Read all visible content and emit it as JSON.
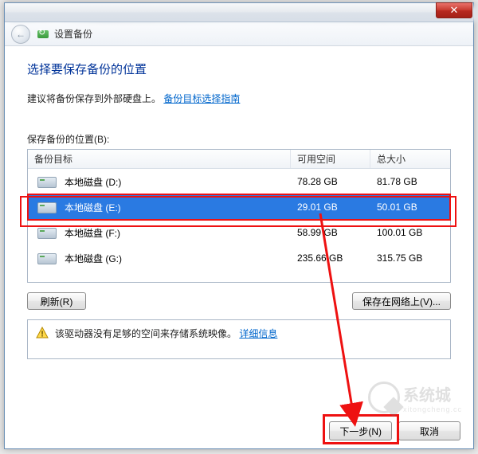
{
  "window": {
    "close_glyph": "✕"
  },
  "header": {
    "back_glyph": "←",
    "title": "设置备份"
  },
  "main": {
    "title": "选择要保存备份的位置",
    "instruction": "建议将备份保存到外部硬盘上。",
    "guide_link": "备份目标选择指南",
    "location_label": "保存备份的位置(B):"
  },
  "table": {
    "col_target": "备份目标",
    "col_free": "可用空间",
    "col_total": "总大小",
    "rows": [
      {
        "name": "本地磁盘 (D:)",
        "free": "78.28 GB",
        "total": "81.78 GB",
        "selected": false
      },
      {
        "name": "本地磁盘 (E:)",
        "free": "29.01 GB",
        "total": "50.01 GB",
        "selected": true
      },
      {
        "name": "本地磁盘 (F:)",
        "free": "58.99 GB",
        "total": "100.01 GB",
        "selected": false
      },
      {
        "name": "本地磁盘 (G:)",
        "free": "235.66 GB",
        "total": "315.75 GB",
        "selected": false
      }
    ]
  },
  "buttons": {
    "refresh": "刷新(R)",
    "save_network": "保存在网络上(V)...",
    "next": "下一步(N)",
    "cancel": "取消"
  },
  "warning": {
    "text": "该驱动器没有足够的空间来存储系统映像。",
    "details_link": "详细信息"
  },
  "watermark": {
    "text": "系统城",
    "sub": "xitongcheng.cc"
  }
}
